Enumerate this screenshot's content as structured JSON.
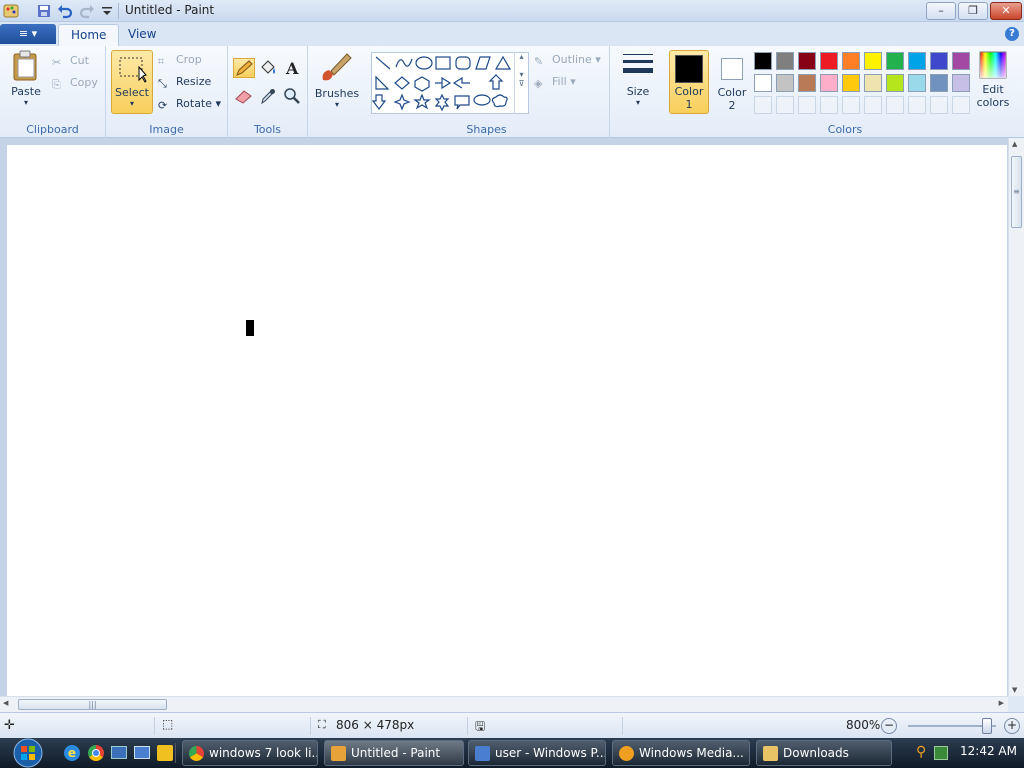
{
  "window": {
    "title": "Untitled - Paint"
  },
  "tabs": [
    {
      "label": "Home"
    },
    {
      "label": "View"
    }
  ],
  "clipboard": {
    "paste": "Paste",
    "cut": "Cut",
    "copy": "Copy",
    "group": "Clipboard"
  },
  "image": {
    "select": "Select",
    "crop": "Crop",
    "resize": "Resize",
    "rotate": "Rotate",
    "group": "Image"
  },
  "tools": {
    "group": "Tools"
  },
  "brushes": {
    "label": "Brushes"
  },
  "shapes": {
    "outline": "Outline",
    "fill": "Fill",
    "group": "Shapes"
  },
  "size": {
    "label": "Size"
  },
  "colors": {
    "color1_label": "Color",
    "color1_num": "1",
    "color2_label": "Color",
    "color2_num": "2",
    "edit_label": "Edit",
    "edit_label2": "colors",
    "group": "Colors",
    "color1": "#000000",
    "color2": "#ffffff",
    "palette_row1": [
      "#000000",
      "#7f7f7f",
      "#880015",
      "#ed1c24",
      "#ff7f27",
      "#fff200",
      "#22b14c",
      "#00a2e8",
      "#3f48cc",
      "#a349a4"
    ],
    "palette_row2": [
      "#ffffff",
      "#c3c3c3",
      "#b97a57",
      "#ffaec9",
      "#ffc90e",
      "#efe4b0",
      "#b5e61d",
      "#99d9ea",
      "#7092be",
      "#c8bfe7"
    ]
  },
  "status": {
    "dimensions": "806 × 478px",
    "zoom": "800%"
  },
  "taskbar": {
    "items": [
      {
        "label": "windows 7 look li...",
        "color": "#e94335"
      },
      {
        "label": "Untitled - Paint",
        "color": "#e8a23a"
      },
      {
        "label": "user - Windows P...",
        "color": "#4a7fd0"
      },
      {
        "label": "Windows Media...",
        "color": "#f0a020"
      },
      {
        "label": "Downloads",
        "color": "#e9c466"
      }
    ],
    "clock": "12:42 AM"
  }
}
